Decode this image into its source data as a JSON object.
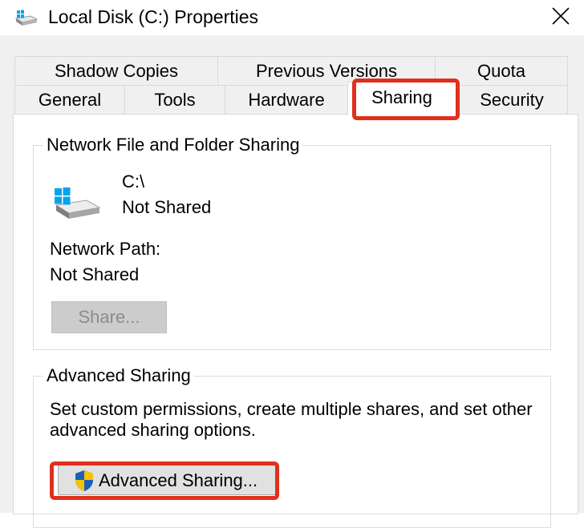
{
  "window": {
    "title": "Local Disk (C:) Properties",
    "close_icon": "close-icon",
    "drive_icon": "drive-icon"
  },
  "tabs": {
    "row1": [
      "Shadow Copies",
      "Previous Versions",
      "Quota"
    ],
    "row2": [
      "General",
      "Tools",
      "Hardware",
      "Sharing",
      "Security"
    ],
    "active": "Sharing"
  },
  "network_sharing": {
    "legend": "Network File and Folder Sharing",
    "path": "C:\\",
    "status": "Not Shared",
    "network_path_label": "Network Path:",
    "network_path_value": "Not Shared",
    "share_button": "Share...",
    "share_button_enabled": false
  },
  "advanced_sharing": {
    "legend": "Advanced Sharing",
    "description_line1": "Set custom permissions, create multiple shares, and set other",
    "description_line2": "advanced sharing options.",
    "button": "Advanced Sharing...",
    "button_icon": "uac-shield-icon"
  },
  "colors": {
    "highlight": "#e0301e",
    "windows_blue": "#00a4ef",
    "shield_blue": "#1c5fb8",
    "shield_yellow": "#f5c400"
  }
}
